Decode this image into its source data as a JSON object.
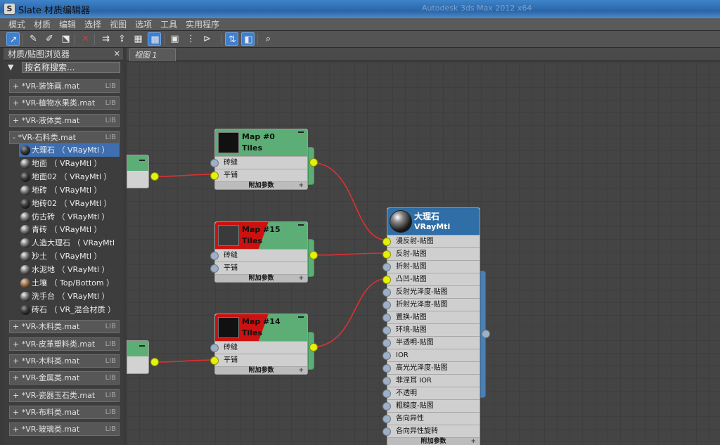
{
  "window": {
    "title": "Slate 材质编辑器",
    "ghost_title": "Autodesk 3ds Max 2012 x64"
  },
  "menubar": [
    "模式",
    "材质",
    "编辑",
    "选择",
    "视图",
    "选项",
    "工具",
    "实用程序"
  ],
  "toolbar": [
    "select-arrow-icon",
    "eyedropper-icon",
    "pick-material-icon",
    "assign-material-icon",
    "delete-icon",
    "move-children-icon",
    "lift-icon",
    "show-map-icon",
    "checker-background-icon",
    "preview-icon",
    "node-layout-icon",
    "hide-unused-icon",
    "slot-options-icon",
    "navigator-icon",
    "zoom-icon"
  ],
  "browser": {
    "title": "材质/贴图浏览器",
    "search_placeholder": "按名称搜索...",
    "libraries_top": [
      {
        "label": "+ *VR-装饰画.mat",
        "tag": "LIB"
      },
      {
        "label": "+ *VR-植物水果类.mat",
        "tag": "LIB"
      },
      {
        "label": "+ *VR-液体类.mat",
        "tag": "LIB"
      },
      {
        "label": "- *VR-石料类.mat",
        "tag": "LIB"
      }
    ],
    "materials": [
      {
        "label": "大理石 （ VRayMtl ）",
        "ball": "dark"
      },
      {
        "label": "地面 （ VRayMtl ）",
        "ball": ""
      },
      {
        "label": "地面02 （ VRayMtl ）",
        "ball": "dark"
      },
      {
        "label": "地砖 （ VRayMtl ）",
        "ball": ""
      },
      {
        "label": "地砖02 （ VRayMtl ）",
        "ball": "dark"
      },
      {
        "label": "仿古砖 （ VRayMtl ）",
        "ball": ""
      },
      {
        "label": "青砖 （ VRayMtl ）",
        "ball": ""
      },
      {
        "label": "人造大理石 （ VRayMtl ）",
        "ball": ""
      },
      {
        "label": "沙土 （ VRayMtl ）",
        "ball": ""
      },
      {
        "label": "水泥地 （ VRayMtl ）",
        "ball": ""
      },
      {
        "label": "土壤 （ Top/Bottom ）",
        "ball": "brown"
      },
      {
        "label": "洗手台 （ VRayMtl ）",
        "ball": ""
      },
      {
        "label": "砖石 （ VR_混合材质 ）",
        "ball": "dark"
      }
    ],
    "libraries_bottom": [
      {
        "label": "+ *VR-木料类.mat",
        "tag": "LIB"
      },
      {
        "label": "+ *VR-皮革塑料类.mat",
        "tag": "LIB"
      },
      {
        "label": "+ *VR-木料类.mat",
        "tag": "LIB"
      },
      {
        "label": "+ *VR-金属类.mat",
        "tag": "LIB"
      },
      {
        "label": "+ *VR-瓷器玉石类.mat",
        "tag": "LIB"
      },
      {
        "label": "+ *VR-布料类.mat",
        "tag": "LIB"
      },
      {
        "label": "+ *VR-玻璃类.mat",
        "tag": "LIB"
      }
    ]
  },
  "view_tab": "视图 1",
  "map_nodes": [
    {
      "name": "Map #0",
      "type": "Tiles",
      "rows": [
        "砖缝",
        "平铺"
      ],
      "footer": "附加参数"
    },
    {
      "name": "Map #15",
      "type": "Tiles",
      "rows": [
        "砖缝",
        "平铺"
      ],
      "footer": "附加参数"
    },
    {
      "name": "Map #14",
      "type": "Tiles",
      "rows": [
        "砖缝",
        "平铺"
      ],
      "footer": "附加参数"
    }
  ],
  "material_node": {
    "name": "大理石",
    "type": "VRayMtl",
    "rows": [
      "漫反射-贴图",
      "反射-贴图",
      "折射-贴图",
      "凸凹-贴图",
      "反射光泽度-贴图",
      "折射光泽度-贴图",
      "置换-贴图",
      "环境-贴图",
      "半透明-贴图",
      "IOR",
      "高光光泽度-贴图",
      "菲涅耳 IOR",
      "不透明",
      "粗糙度-贴图",
      "各向异性",
      "各向异性旋转"
    ],
    "footer": "附加参数"
  },
  "colors": {
    "node_green": "#5cae76",
    "socket_active": "#e3f20a",
    "wire": "#e03030",
    "material_head": "#2f6ea6"
  }
}
